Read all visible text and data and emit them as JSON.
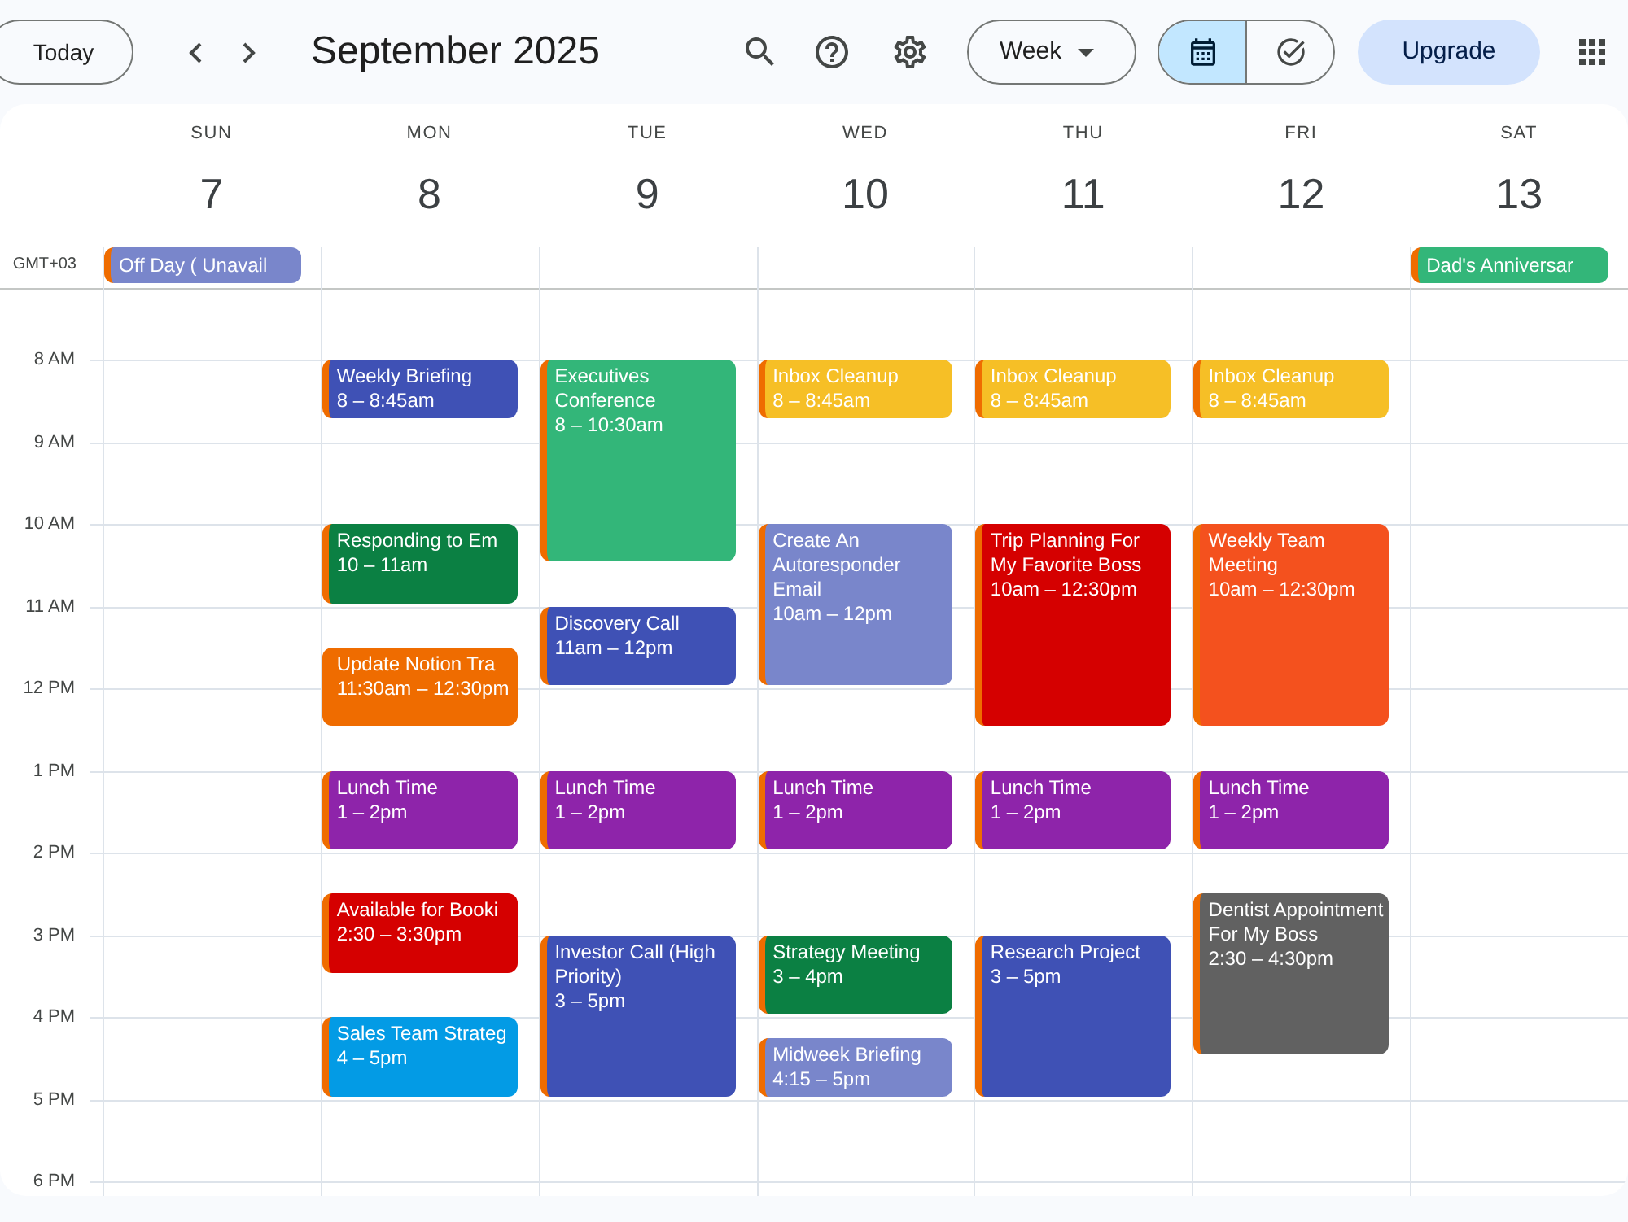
{
  "toolbar": {
    "today": "Today",
    "title": "September 2025",
    "view_select": "Week",
    "view_toggle": [
      {
        "kind": "calendar",
        "selected": true
      },
      {
        "kind": "tasks",
        "selected": false
      }
    ],
    "upgrade": "Upgrade"
  },
  "calendar": {
    "timezone": "GMT+03",
    "hours": [
      "8 AM",
      "9 AM",
      "10 AM",
      "11 AM",
      "12 PM",
      "1 PM",
      "2 PM",
      "3 PM",
      "4 PM",
      "5 PM",
      "6 PM"
    ],
    "days": [
      {
        "weekday": "SUN",
        "date": "7",
        "all_day": [
          {
            "title": "Off Day ( Unavail",
            "color": "#7986cb"
          }
        ]
      },
      {
        "weekday": "MON",
        "date": "8",
        "events": [
          {
            "title": "Weekly Briefing",
            "time": "8 – 8:45am",
            "color": "#3f51b5"
          },
          {
            "title": "Responding to Em",
            "time": "10 – 11am",
            "color": "#0b8043"
          },
          {
            "title": "Update Notion Tra",
            "time": "11:30am – 12:30pm",
            "color": "#ef6c00"
          },
          {
            "title": "Lunch Time",
            "time": "1 – 2pm",
            "color": "#8e24aa"
          },
          {
            "title": "Available for Booki",
            "time": "2:30 – 3:30pm",
            "color": "#d50000"
          },
          {
            "title": "Sales Team Strateg",
            "time": "4 – 5pm",
            "color": "#039be5"
          }
        ]
      },
      {
        "weekday": "TUE",
        "date": "9",
        "events": [
          {
            "title": "Executives Conference",
            "time": "8 – 10:30am",
            "color": "#33b679"
          },
          {
            "title": "Discovery Call",
            "time": "11am – 12pm",
            "color": "#3f51b5"
          },
          {
            "title": "Lunch Time",
            "time": "1 – 2pm",
            "color": "#8e24aa"
          },
          {
            "title": "Investor Call (High Priority)",
            "time": "3 – 5pm",
            "color": "#3f51b5"
          }
        ]
      },
      {
        "weekday": "WED",
        "date": "10",
        "events": [
          {
            "title": "Inbox Cleanup",
            "time": "8 – 8:45am",
            "color": "#f6bf26"
          },
          {
            "title": "Create An Autoresponder Email",
            "time": "10am – 12pm",
            "color": "#7986cb"
          },
          {
            "title": "Lunch Time",
            "time": "1 – 2pm",
            "color": "#8e24aa"
          },
          {
            "title": "Strategy Meeting",
            "time": "3 – 4pm",
            "color": "#0b8043"
          },
          {
            "title": "Midweek Briefing",
            "time": "4:15 – 5pm",
            "color": "#7986cb"
          }
        ]
      },
      {
        "weekday": "THU",
        "date": "11",
        "events": [
          {
            "title": "Inbox Cleanup",
            "time": "8 – 8:45am",
            "color": "#f6bf26"
          },
          {
            "title": "Trip Planning For My Favorite Boss",
            "time": "10am – 12:30pm",
            "color": "#d50000"
          },
          {
            "title": "Lunch Time",
            "time": "1 – 2pm",
            "color": "#8e24aa"
          },
          {
            "title": "Research Project",
            "time": "3 – 5pm",
            "color": "#3f51b5"
          }
        ]
      },
      {
        "weekday": "FRI",
        "date": "12",
        "events": [
          {
            "title": "Inbox Cleanup",
            "time": "8 – 8:45am",
            "color": "#f6bf26"
          },
          {
            "title": "Weekly Team Meeting",
            "time": "10am – 12:30pm",
            "color": "#f4511e"
          },
          {
            "title": "Lunch Time",
            "time": "1 – 2pm",
            "color": "#8e24aa"
          },
          {
            "title": "Dentist Appointment For My Boss",
            "time": "2:30 – 4:30pm",
            "color": "#616161"
          }
        ]
      },
      {
        "weekday": "SAT",
        "date": "13",
        "all_day": [
          {
            "title": "Dad's Anniversar",
            "color": "#33b679"
          }
        ]
      }
    ]
  }
}
